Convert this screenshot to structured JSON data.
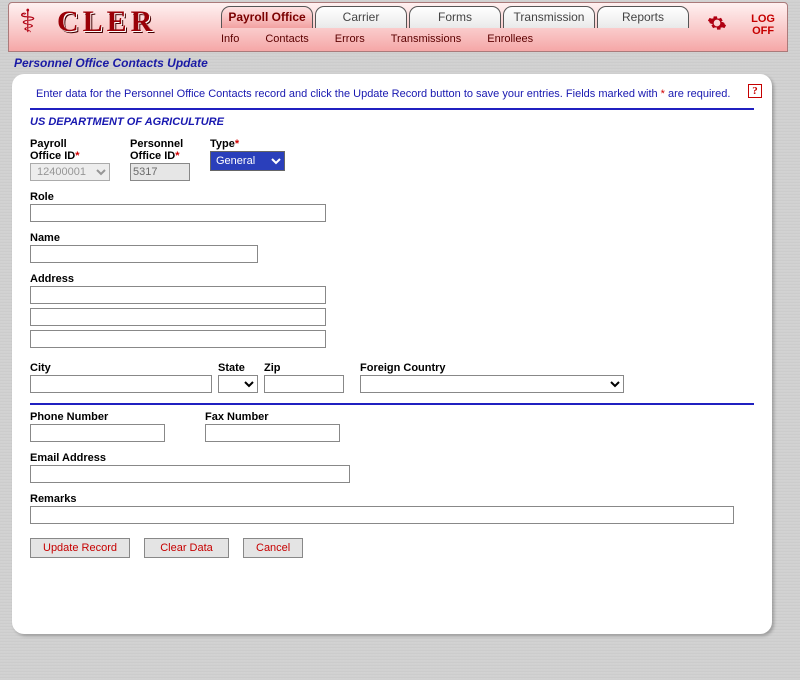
{
  "app": {
    "name": "CLER",
    "logoff": "LOG\nOFF"
  },
  "nav": {
    "tabs": [
      {
        "label": "Payroll Office",
        "active": true
      },
      {
        "label": "Carrier"
      },
      {
        "label": "Forms"
      },
      {
        "label": "Transmission"
      },
      {
        "label": "Reports"
      }
    ],
    "subnav": [
      "Info",
      "Contacts",
      "Errors",
      "Transmissions",
      "Enrollees"
    ]
  },
  "page": {
    "title": "Personnel Office Contacts Update",
    "intro_a": "Enter data for the Personnel Office Contacts record and click the Update Record button to save your entries.  Fields marked with ",
    "intro_req": "*",
    "intro_b": " are required.",
    "department": "US DEPARTMENT OF AGRICULTURE",
    "help_glyph": "?"
  },
  "form": {
    "payroll_office_id": {
      "label": "Payroll\nOffice ID",
      "value": "12400001"
    },
    "personnel_office_id": {
      "label": "Personnel\nOffice ID",
      "value": "5317"
    },
    "type": {
      "label": "Type",
      "value": "General",
      "options": [
        "General"
      ]
    },
    "role": {
      "label": "Role",
      "value": ""
    },
    "name": {
      "label": "Name",
      "value": ""
    },
    "address": {
      "label": "Address",
      "line1": "",
      "line2": "",
      "line3": ""
    },
    "city": {
      "label": "City",
      "value": ""
    },
    "state": {
      "label": "State",
      "value": ""
    },
    "zip": {
      "label": "Zip",
      "value": ""
    },
    "foreign_country": {
      "label": "Foreign Country",
      "value": ""
    },
    "phone": {
      "label": "Phone Number",
      "value": ""
    },
    "fax": {
      "label": "Fax Number",
      "value": ""
    },
    "email": {
      "label": "Email Address",
      "value": ""
    },
    "remarks": {
      "label": "Remarks",
      "value": ""
    }
  },
  "buttons": {
    "update": "Update Record",
    "clear": "Clear Data",
    "cancel": "Cancel"
  }
}
